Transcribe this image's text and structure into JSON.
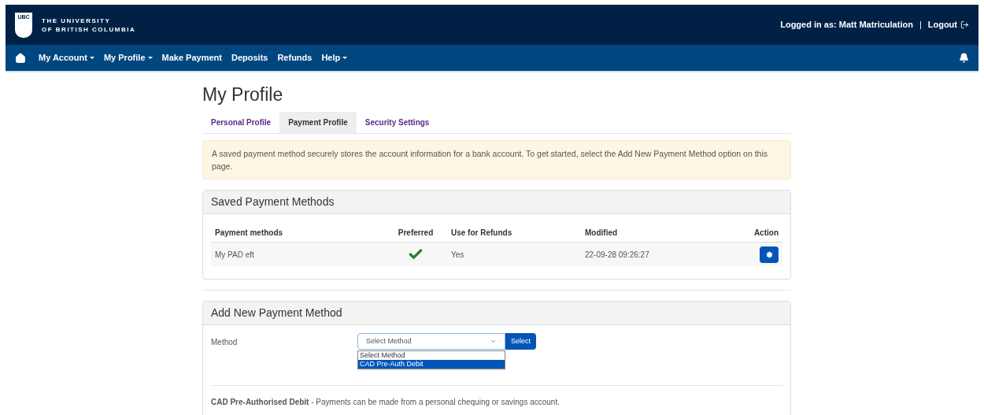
{
  "header": {
    "logo_text": "UBC",
    "university_line1": "THE UNIVERSITY",
    "university_line2": "OF BRITISH COLUMBIA",
    "logged_in": "Logged in as: Matt Matriculation",
    "separator": "|",
    "logout": "Logout"
  },
  "nav": [
    {
      "label": "My Account",
      "dropdown": true
    },
    {
      "label": "My Profile",
      "dropdown": true
    },
    {
      "label": "Make Payment",
      "dropdown": false
    },
    {
      "label": "Deposits",
      "dropdown": false
    },
    {
      "label": "Refunds",
      "dropdown": false
    },
    {
      "label": "Help",
      "dropdown": true
    }
  ],
  "page_title": "My Profile",
  "tabs": [
    {
      "label": "Personal Profile",
      "selected": false
    },
    {
      "label": "Payment Profile",
      "selected": true
    },
    {
      "label": "Security Settings",
      "selected": false
    }
  ],
  "alert": "A saved payment method securely stores the account information for a bank account. To get started, select the Add New Payment Method option on this page.",
  "saved_card": {
    "title": "Saved Payment Methods",
    "columns": [
      "Payment methods",
      "Preferred",
      "Use for Refunds",
      "Modified",
      "Action"
    ],
    "rows": [
      {
        "name": "My PAD eft",
        "preferred": true,
        "refunds": "Yes",
        "modified": "22-09-28 09:26:27"
      }
    ]
  },
  "add_card": {
    "title": "Add New Payment Method",
    "field_label": "Method",
    "value": "Select Method",
    "button": "Select",
    "options": [
      {
        "label": "Select Method",
        "highlighted": false
      },
      {
        "label": "CAD Pre-Auth Debit",
        "highlighted": true
      }
    ],
    "note": "**CAD Pre-Authorised Debit** - Payments can be made from a personal chequing or savings account."
  }
}
